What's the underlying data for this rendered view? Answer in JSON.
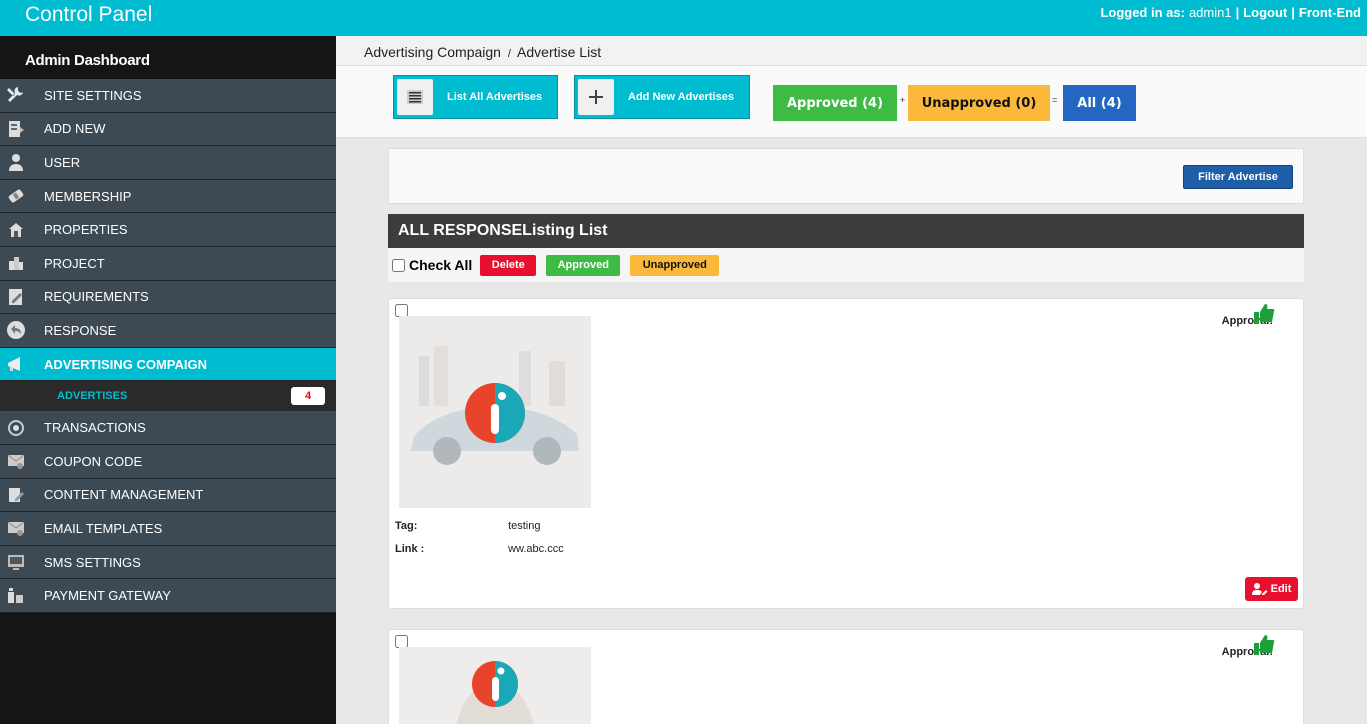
{
  "header": {
    "brand": "Control Panel",
    "logged_in_label": "Logged in as:",
    "username": "admin1",
    "sep1": "|",
    "logout": "Logout",
    "sep2": "|",
    "frontend": "Front-End"
  },
  "sidebar": {
    "title": "Admin Dashboard",
    "items": [
      {
        "label": "SITE SETTINGS",
        "icon": "tools-icon"
      },
      {
        "label": "ADD NEW",
        "icon": "add-document-icon"
      },
      {
        "label": "USER",
        "icon": "user-icon"
      },
      {
        "label": "MEMBERSHIP",
        "icon": "membership-icon"
      },
      {
        "label": "PROPERTIES",
        "icon": "house-icon"
      },
      {
        "label": "PROJECT",
        "icon": "building-icon"
      },
      {
        "label": "REQUIREMENTS",
        "icon": "clipboard-icon"
      },
      {
        "label": "RESPONSE",
        "icon": "reply-icon"
      },
      {
        "label": "ADVERTISING COMPAIGN",
        "icon": "megaphone-icon"
      },
      {
        "label": "TRANSACTIONS",
        "icon": "transactions-icon"
      },
      {
        "label": "COUPON CODE",
        "icon": "coupon-icon"
      },
      {
        "label": "CONTENT MANAGEMENT",
        "icon": "content-icon"
      },
      {
        "label": "EMAIL TEMPLATES",
        "icon": "email-icon"
      },
      {
        "label": "SMS SETTINGS",
        "icon": "sms-icon"
      },
      {
        "label": "PAYMENT GATEWAY",
        "icon": "payment-icon"
      }
    ],
    "sub_item": {
      "label": "ADVERTISES",
      "count": "4"
    }
  },
  "breadcrumb": {
    "parent": "Advertising Compaign",
    "sep": "/",
    "current": "Advertise List"
  },
  "toolbar": {
    "list_all": "List All Advertises",
    "add_new": "Add New Advertises",
    "approved": "Approved (4)",
    "plus": "+",
    "unapproved": "Unapproved (0)",
    "equals": "=",
    "all": "All (4)"
  },
  "filter": {
    "button": "Filter Advertise"
  },
  "list": {
    "title": "ALL RESPONSEListing List",
    "check_all": "Check All",
    "delete": "Delete",
    "approved": "Approved",
    "unapproved": "Unapproved"
  },
  "cards": [
    {
      "approval_label": "Approval:",
      "tag_label": "Tag:",
      "tag": "testing",
      "link_label": "Link :",
      "link": "ww.abc.ccc",
      "edit": "Edit"
    },
    {
      "approval_label": "Approval:"
    }
  ],
  "colors": {
    "accent": "#00bcd0",
    "approved": "#3dbb45",
    "unapproved": "#fbb93b",
    "all": "#2367c2",
    "danger": "#e8102e"
  }
}
